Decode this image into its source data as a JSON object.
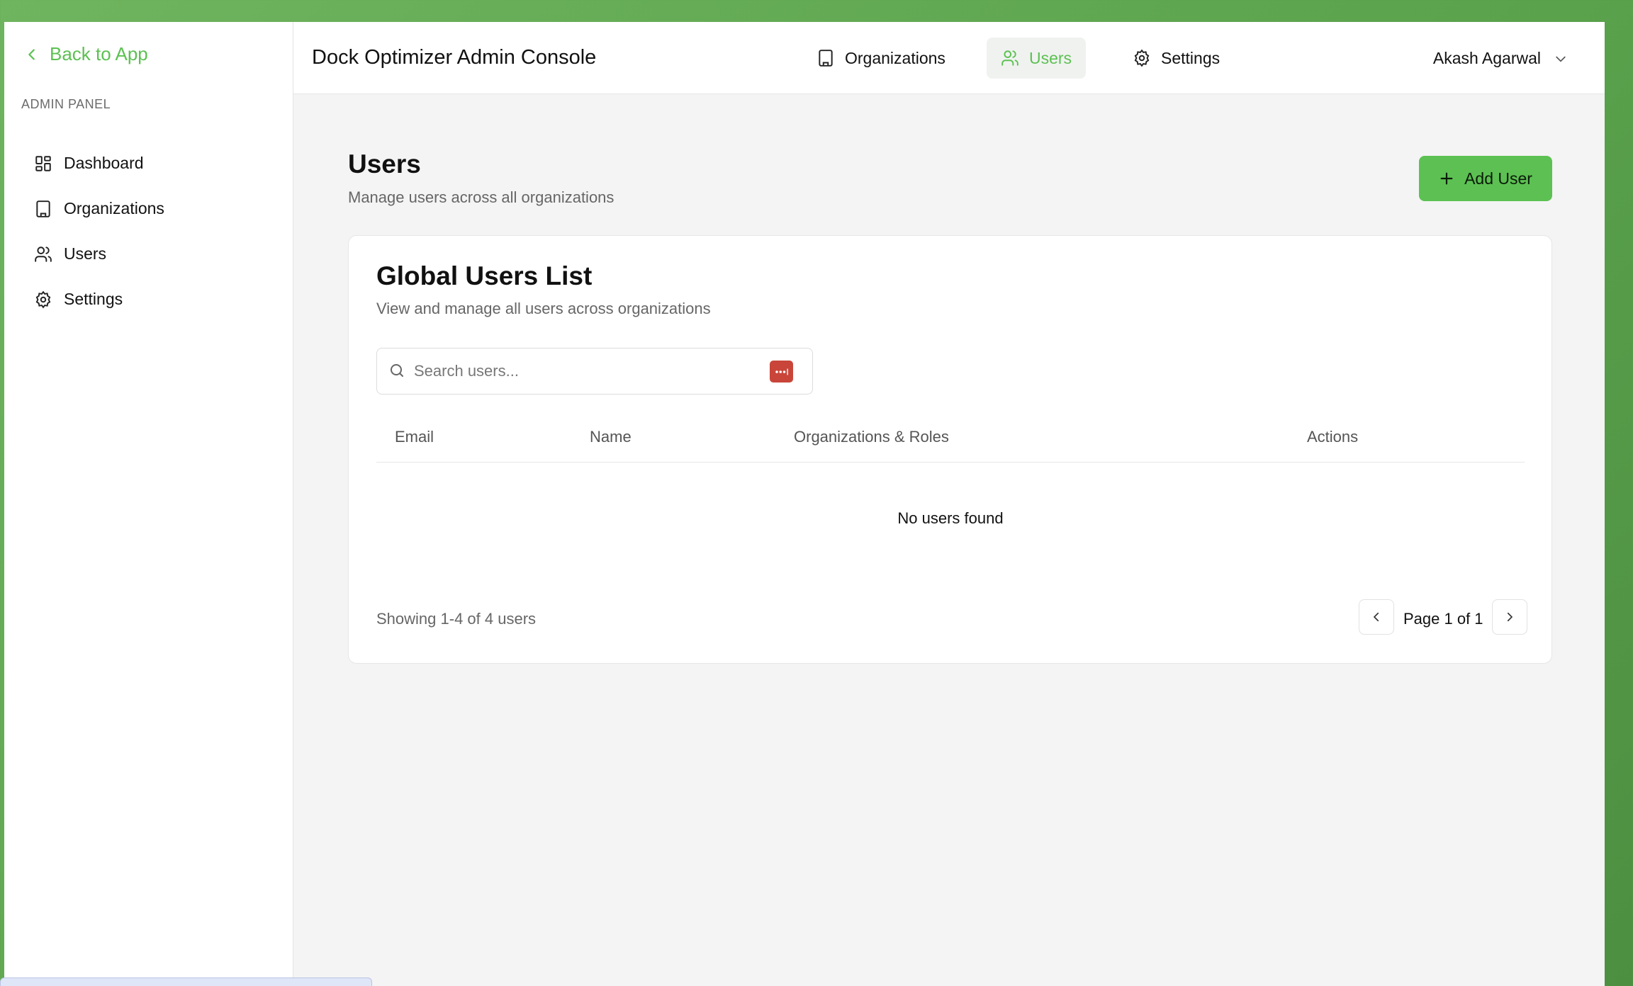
{
  "sidebar": {
    "back_label": "Back to App",
    "section_label": "ADMIN PANEL",
    "items": [
      {
        "label": "Dashboard",
        "icon": "dashboard-icon"
      },
      {
        "label": "Organizations",
        "icon": "building-icon"
      },
      {
        "label": "Users",
        "icon": "users-icon"
      },
      {
        "label": "Settings",
        "icon": "gear-icon"
      }
    ]
  },
  "header": {
    "title": "Dock Optimizer Admin Console",
    "nav": [
      {
        "label": "Organizations",
        "icon": "building-icon",
        "active": false
      },
      {
        "label": "Users",
        "icon": "users-icon",
        "active": true
      },
      {
        "label": "Settings",
        "icon": "gear-icon",
        "active": false
      }
    ],
    "user_name": "Akash Agarwal"
  },
  "page": {
    "title": "Users",
    "subtitle": "Manage users across all organizations",
    "add_button": "Add User"
  },
  "card": {
    "title": "Global Users List",
    "subtitle": "View and manage all users across organizations",
    "search_placeholder": "Search users...",
    "columns": [
      "Email",
      "Name",
      "Organizations & Roles",
      "Actions"
    ],
    "empty_text": "No users found",
    "showing_text": "Showing 1-4 of 4 users",
    "page_text": "Page 1 of 1"
  },
  "colors": {
    "accent": "#5cc152",
    "desktop_green": "#5aa24c",
    "password_badge": "#c9453a"
  }
}
